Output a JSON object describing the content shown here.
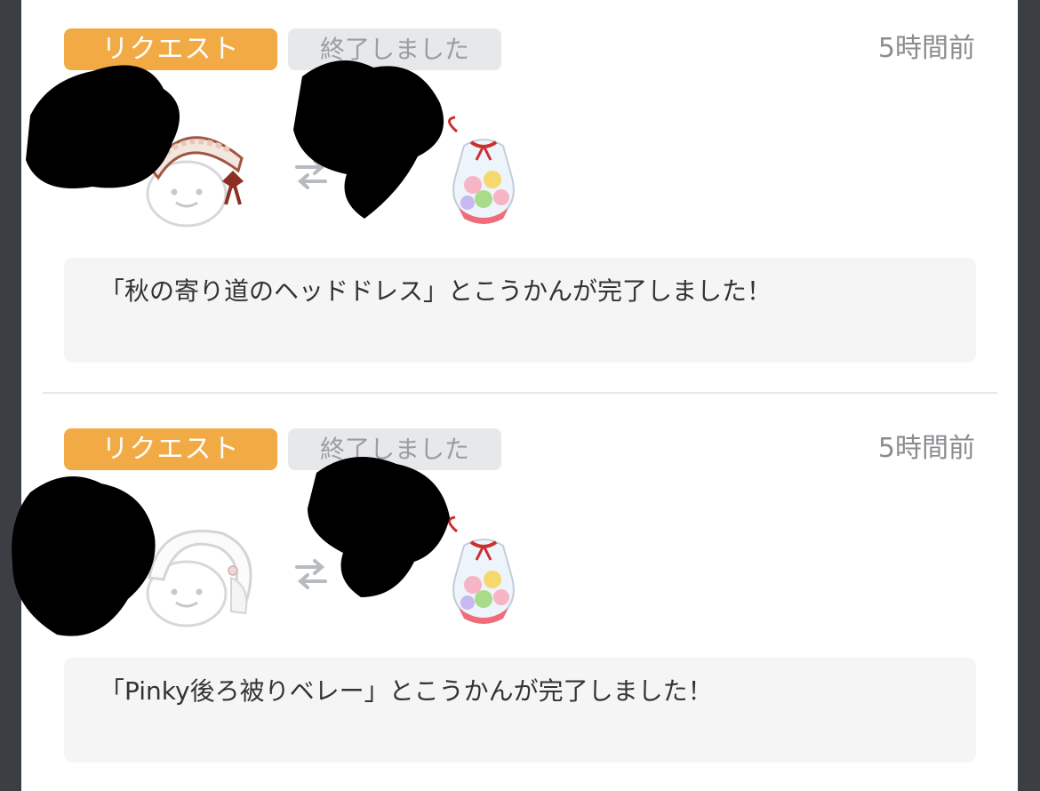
{
  "entries": [
    {
      "request_label": "リクエスト",
      "status_label": "終了しました",
      "time": "5時間前",
      "message": "「秋の寄り道のヘッドドレス」とこうかんが完了しました！",
      "left_item_icon": "headdress-avatar-icon",
      "right_item_icon": "candy-bag-icon"
    },
    {
      "request_label": "リクエスト",
      "status_label": "終了しました",
      "time": "5時間前",
      "message": "「Pinky後ろ被りベレー」とこうかんが完了しました！",
      "left_item_icon": "beret-avatar-icon",
      "right_item_icon": "candy-bag-icon"
    }
  ],
  "colors": {
    "request_badge": "#f2aa45",
    "status_badge": "#e6e8ea",
    "background": "#3b3e42"
  }
}
